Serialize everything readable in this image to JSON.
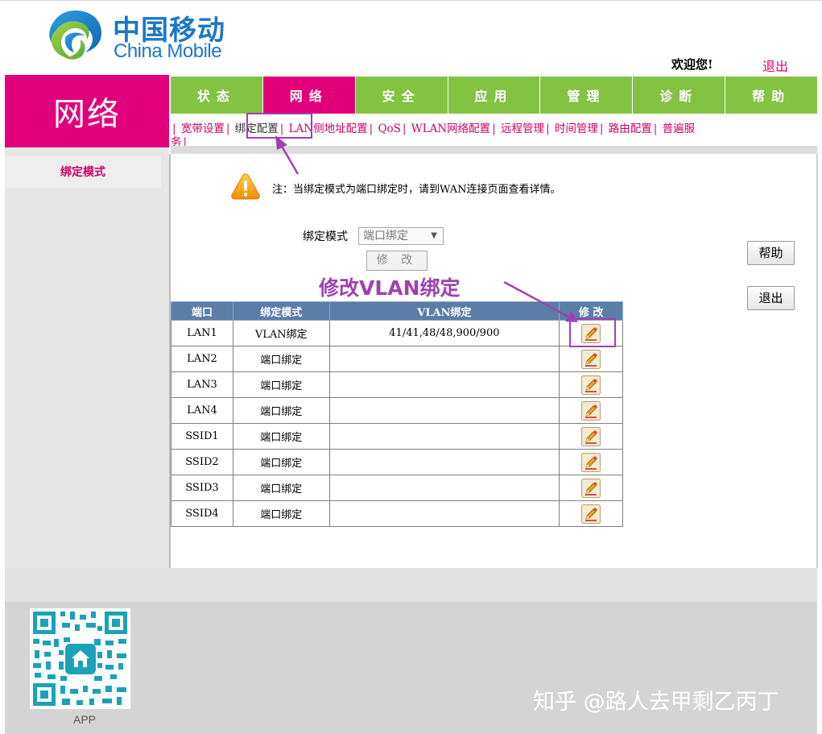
{
  "brand": {
    "name_cn": "中国移动",
    "name_en": "China Mobile",
    "logo_icon": "china-mobile-logo",
    "accent_color": "#e2007a",
    "tab_color": "#82c341",
    "logo_color": "#1978c8"
  },
  "header": {
    "welcome": "欢迎您!",
    "logout": "退出"
  },
  "section_title": "网络",
  "tabs": [
    {
      "label": "状态",
      "active": false
    },
    {
      "label": "网络",
      "active": true
    },
    {
      "label": "安全",
      "active": false
    },
    {
      "label": "应用",
      "active": false
    },
    {
      "label": "管理",
      "active": false
    },
    {
      "label": "诊断",
      "active": false
    },
    {
      "label": "帮助",
      "active": false
    }
  ],
  "subnav": [
    {
      "label": "宽带设置",
      "active": false
    },
    {
      "label": "绑定配置",
      "active": true
    },
    {
      "label": "LAN侧地址配置",
      "active": false
    },
    {
      "label": "QoS",
      "active": false
    },
    {
      "label": "WLAN网络配置",
      "active": false
    },
    {
      "label": "远程管理",
      "active": false
    },
    {
      "label": "时间管理",
      "active": false
    },
    {
      "label": "路由配置",
      "active": false
    },
    {
      "label": "普遍服",
      "active": false
    }
  ],
  "subnav_wrap": "务",
  "sidebar": {
    "items": [
      {
        "label": "绑定模式",
        "active": true
      }
    ]
  },
  "content": {
    "note": "注：当绑定模式为端口绑定时，请到WAN连接页面查看详情。",
    "warning_icon": "warning-icon",
    "bind_mode_label": "绑定模式",
    "bind_mode_value": "端口绑定",
    "modify_button": "修 改",
    "help_button": "帮助",
    "exit_button": "退出",
    "annotation": "修改VLAN绑定"
  },
  "table": {
    "headers": [
      "端口",
      "绑定模式",
      "VLAN绑定",
      "修 改"
    ],
    "rows": [
      {
        "port": "LAN1",
        "mode": "VLAN绑定",
        "vlan": "41/41,48/48,900/900"
      },
      {
        "port": "LAN2",
        "mode": "端口绑定",
        "vlan": ""
      },
      {
        "port": "LAN3",
        "mode": "端口绑定",
        "vlan": ""
      },
      {
        "port": "LAN4",
        "mode": "端口绑定",
        "vlan": ""
      },
      {
        "port": "SSID1",
        "mode": "端口绑定",
        "vlan": ""
      },
      {
        "port": "SSID2",
        "mode": "端口绑定",
        "vlan": ""
      },
      {
        "port": "SSID3",
        "mode": "端口绑定",
        "vlan": ""
      },
      {
        "port": "SSID4",
        "mode": "端口绑定",
        "vlan": ""
      }
    ],
    "edit_icon": "edit-pencil-icon"
  },
  "footer": {
    "qr_icon": "app-qr-code",
    "app_label": "APP",
    "watermark": "知乎 @路人去甲剩乙丙丁"
  }
}
